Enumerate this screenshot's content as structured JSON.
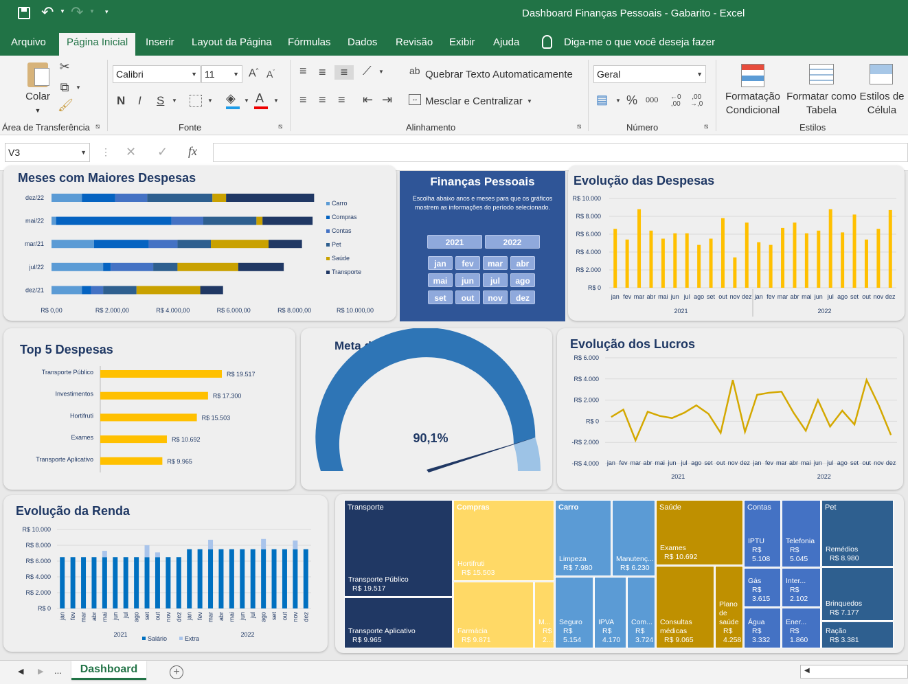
{
  "window": {
    "title": "Dashboard Finanças Pessoais - Gabarito  -  Excel"
  },
  "tabs": [
    "Arquivo",
    "Página Inicial",
    "Inserir",
    "Layout da Página",
    "Fórmulas",
    "Dados",
    "Revisão",
    "Exibir",
    "Ajuda"
  ],
  "tell_me": "Diga-me o que você deseja fazer",
  "ribbon": {
    "paste_label": "Colar",
    "clipboard_group": "Área de Transferência",
    "font_name": "Calibri",
    "font_size": "11",
    "font_group": "Fonte",
    "bold": "N",
    "italic": "I",
    "underline": "S",
    "wrap_text": "Quebrar Texto Automaticamente",
    "merge_center": "Mesclar e Centralizar",
    "alignment_group": "Alinhamento",
    "number_format": "Geral",
    "number_group": "Número",
    "percent": "%",
    "thousands": "000",
    "cond_format_1": "Formatação",
    "cond_format_2": "Condicional",
    "format_table_1": "Formatar como",
    "format_table_2": "Tabela",
    "cell_styles_1": "Estilos de",
    "cell_styles_2": "Célula",
    "styles_group": "Estilos"
  },
  "formula_bar": {
    "name_box": "V3",
    "fx": "fx",
    "value": ""
  },
  "sheet_tab": "Dashboard",
  "dashboard": {
    "title": "Finanças Pessoais",
    "subtitle": "Escolha abaixo anos e meses para que os gráficos mostrem as informações do período selecionado.",
    "years": [
      "2021",
      "2022"
    ],
    "months": [
      "jan",
      "fev",
      "mar",
      "abr",
      "mai",
      "jun",
      "jul",
      "ago",
      "set",
      "out",
      "nov",
      "dez"
    ]
  },
  "colors": {
    "excel_green": "#217346",
    "navy": "#1f3864",
    "gold": "#ffc000",
    "dark_gold": "#c39a00",
    "blue": "#2e75b6"
  },
  "chart_data": [
    {
      "type": "bar",
      "title": "Meses com Maiores Despesas",
      "orientation": "horizontal",
      "stacked": true,
      "categories": [
        "dez/22",
        "mai/22",
        "mar/21",
        "jul/22",
        "dez/21"
      ],
      "xticks": [
        "R$ 0,00",
        "R$ 2.000,00",
        "R$ 4.000,00",
        "R$ 6.000,00",
        "R$ 8.000,00",
        "R$ 10.000,00"
      ],
      "xlim": [
        0,
        10000
      ],
      "legend_position": "right",
      "series": [
        {
          "name": "Carro",
          "color": "#5b9bd5",
          "values": [
            1000,
            150,
            1400,
            1700,
            1000
          ]
        },
        {
          "name": "Compras",
          "color": "#0563c1",
          "values": [
            1100,
            3800,
            1800,
            250,
            300
          ]
        },
        {
          "name": "Contas",
          "color": "#4472c4",
          "values": [
            1050,
            1050,
            950,
            1400,
            400
          ]
        },
        {
          "name": "Pet",
          "color": "#2e5f8f",
          "values": [
            2150,
            1750,
            1100,
            800,
            1100
          ]
        },
        {
          "name": "Saúde",
          "color": "#c9a100",
          "values": [
            450,
            200,
            1900,
            2000,
            2100
          ]
        },
        {
          "name": "Transporte",
          "color": "#203864",
          "values": [
            2900,
            1650,
            1100,
            1500,
            750
          ]
        }
      ]
    },
    {
      "type": "bar",
      "title": "Evolução das Despesas",
      "categories": [
        "jan",
        "fev",
        "mar",
        "abr",
        "mai",
        "jun",
        "jul",
        "ago",
        "set",
        "out",
        "nov",
        "dez",
        "jan",
        "fev",
        "mar",
        "abr",
        "mai",
        "jun",
        "jul",
        "ago",
        "set",
        "out",
        "nov",
        "dez"
      ],
      "groups": [
        "2021",
        "2022"
      ],
      "yticks": [
        "R$ 0",
        "R$ 2.000",
        "R$ 4.000",
        "R$ 6.000",
        "R$ 8.000",
        "R$ 10.000"
      ],
      "ylim": [
        0,
        10000
      ],
      "series": [
        {
          "values": [
            6600,
            5400,
            8800,
            6400,
            5500,
            6100,
            6100,
            4800,
            5500,
            7800,
            3400,
            7300,
            5100,
            4800,
            6700,
            7300,
            6100,
            6400,
            8800,
            6200,
            8200,
            5400,
            6600,
            8700
          ]
        }
      ]
    },
    {
      "type": "bar",
      "title": "Top 5 Despesas",
      "orientation": "horizontal",
      "categories": [
        "Transporte Público",
        "Investimentos",
        "Hortifruti",
        "Exames",
        "Transporte Aplicativo"
      ],
      "labels": [
        "R$ 19.517",
        "R$ 17.300",
        "R$ 15.503",
        "R$ 10.692",
        "R$ 9.965"
      ],
      "values": [
        19517,
        17300,
        15503,
        10692,
        9965
      ]
    },
    {
      "type": "pie",
      "title": "Meta de Investimento",
      "label": "90,1%",
      "values": [
        90.1
      ]
    },
    {
      "type": "line",
      "title": "Evolução dos Lucros",
      "categories": [
        "jan",
        "fev",
        "mar",
        "abr",
        "mai",
        "jun",
        "jul",
        "ago",
        "set",
        "out",
        "nov",
        "dez",
        "jan",
        "fev",
        "mar",
        "abr",
        "mai",
        "jun",
        "jul",
        "ago",
        "set",
        "out",
        "nov",
        "dez"
      ],
      "groups": [
        "2021",
        "2022"
      ],
      "yticks": [
        "-R$ 4.000",
        "-R$ 2.000",
        "R$ 0",
        "R$ 2.000",
        "R$ 4.000",
        "R$ 6.000"
      ],
      "ylim": [
        -4000,
        6000
      ],
      "series": [
        {
          "values": [
            400,
            1100,
            -1800,
            900,
            500,
            300,
            800,
            1500,
            700,
            -1100,
            3900,
            -1000,
            2500,
            2700,
            2800,
            800,
            -900,
            2000,
            -500,
            1000,
            -300,
            3900,
            1500,
            -1300
          ]
        }
      ]
    },
    {
      "type": "bar",
      "title": "Evolução da Renda",
      "stacked": true,
      "categories": [
        "jan",
        "fev",
        "mar",
        "abr",
        "mai",
        "jun",
        "jul",
        "ago",
        "set",
        "out",
        "nov",
        "dez",
        "jan",
        "fev",
        "mar",
        "abr",
        "mai",
        "jun",
        "jul",
        "ago",
        "set",
        "out",
        "nov",
        "dez"
      ],
      "groups": [
        "2021",
        "2022"
      ],
      "yticks": [
        "R$ 0",
        "R$ 2.000",
        "R$ 4.000",
        "R$ 6.000",
        "R$ 8.000",
        "R$ 10.000"
      ],
      "ylim": [
        0,
        10000
      ],
      "legend_position": "bottom",
      "series": [
        {
          "name": "Salário",
          "color": "#0070c0",
          "values": [
            6500,
            6500,
            6500,
            6500,
            6500,
            6500,
            6500,
            6500,
            6500,
            6500,
            6500,
            6500,
            7500,
            7500,
            7500,
            7500,
            7500,
            7500,
            7500,
            7500,
            7500,
            7500,
            7500,
            7500
          ]
        },
        {
          "name": "Extra",
          "color": "#a9c4eb",
          "values": [
            0,
            0,
            0,
            0,
            800,
            0,
            0,
            0,
            1500,
            600,
            0,
            0,
            0,
            0,
            1200,
            0,
            0,
            0,
            0,
            1300,
            0,
            0,
            1100,
            0
          ]
        }
      ]
    },
    {
      "type": "treemap",
      "title": "",
      "blocks": [
        {
          "label": "Transporte",
          "color": "#203864",
          "text": "#fff"
        },
        {
          "label": "Transporte Público",
          "value": "R$ 19.517",
          "color": "#203864",
          "text": "#fff"
        },
        {
          "label": "Transporte Aplicativo",
          "value": "R$ 9.965",
          "color": "#203864",
          "text": "#fff"
        },
        {
          "label": "Compras",
          "color": "#ffd966",
          "text": "#fff"
        },
        {
          "label": "Hortifruti",
          "value": "R$ 15.503",
          "color": "#ffd966",
          "text": "#fff"
        },
        {
          "label": "Farmácia",
          "value": "R$ 9.871",
          "color": "#ffd966",
          "text": "#fff"
        },
        {
          "label": "M...",
          "value": "R$ 2....",
          "color": "#ffd966",
          "text": "#fff"
        },
        {
          "label": "Carro",
          "color": "#5b9bd5",
          "text": "#fff"
        },
        {
          "label": "Limpeza",
          "value": "R$ 7.980",
          "color": "#5b9bd5",
          "text": "#fff"
        },
        {
          "label": "Manutenç...",
          "value": "R$ 6.230",
          "color": "#5b9bd5",
          "text": "#fff"
        },
        {
          "label": "Seguro",
          "value": "R$ 5.154",
          "color": "#5b9bd5",
          "text": "#fff"
        },
        {
          "label": "IPVA",
          "value": "R$ 4.170",
          "color": "#5b9bd5",
          "text": "#fff"
        },
        {
          "label": "Com...",
          "value": "R$ 3.724",
          "color": "#5b9bd5",
          "text": "#fff"
        },
        {
          "label": "Saúde",
          "color": "#bf9000",
          "text": "#fff"
        },
        {
          "label": "Exames",
          "value": "R$ 10.692",
          "color": "#bf9000",
          "text": "#fff"
        },
        {
          "label": "Consultas médicas",
          "value": "R$ 9.065",
          "color": "#bf9000",
          "text": "#fff"
        },
        {
          "label": "Plano de saúde",
          "value": "R$ 4.258",
          "color": "#bf9000",
          "text": "#fff"
        },
        {
          "label": "Contas",
          "color": "#4472c4",
          "text": "#fff"
        },
        {
          "label": "IPTU",
          "value": "R$ 5.108",
          "color": "#4472c4",
          "text": "#fff"
        },
        {
          "label": "Telefonia",
          "value": "R$ 5.045",
          "color": "#4472c4",
          "text": "#fff"
        },
        {
          "label": "Gás",
          "value": "R$ 3.615",
          "color": "#4472c4",
          "text": "#fff"
        },
        {
          "label": "Inter...",
          "value": "R$ 2.102",
          "color": "#4472c4",
          "text": "#fff"
        },
        {
          "label": "Água",
          "value": "R$ 3.332",
          "color": "#4472c4",
          "text": "#fff"
        },
        {
          "label": "Ener...",
          "value": "R$ 1.860",
          "color": "#4472c4",
          "text": "#fff"
        },
        {
          "label": "Pet",
          "color": "#2e5f8f",
          "text": "#fff"
        },
        {
          "label": "Remédios",
          "value": "R$ 8.980",
          "color": "#2e5f8f",
          "text": "#fff"
        },
        {
          "label": "Brinquedos",
          "value": "R$ 7.177",
          "color": "#2e5f8f",
          "text": "#fff"
        },
        {
          "label": "Ração",
          "value": "R$ 3.381",
          "color": "#2e5f8f",
          "text": "#fff"
        }
      ]
    }
  ]
}
